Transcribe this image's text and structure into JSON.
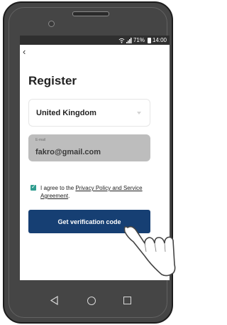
{
  "status": {
    "battery_percent": "71%",
    "time": "14:00"
  },
  "register": {
    "title": "Register",
    "country": "United Kingdom",
    "email_label": "E-mail",
    "email_value": "fakro@gmail.com",
    "agree_prefix": "I agree to the ",
    "agree_link": "Privacy Policy and Service Agreement",
    "agree_suffix": ".",
    "button_label": "Get verification code"
  },
  "icons": {
    "back": "back-icon",
    "dropdown": "chevron-down-icon",
    "checkbox": "check-icon",
    "nav_back": "triangle-back-icon",
    "nav_home": "circle-home-icon",
    "nav_recent": "square-recent-icon"
  },
  "colors": {
    "accent_button": "#163f73",
    "checkbox": "#2f9d8f",
    "email_field_bg": "#bdbdbd"
  }
}
